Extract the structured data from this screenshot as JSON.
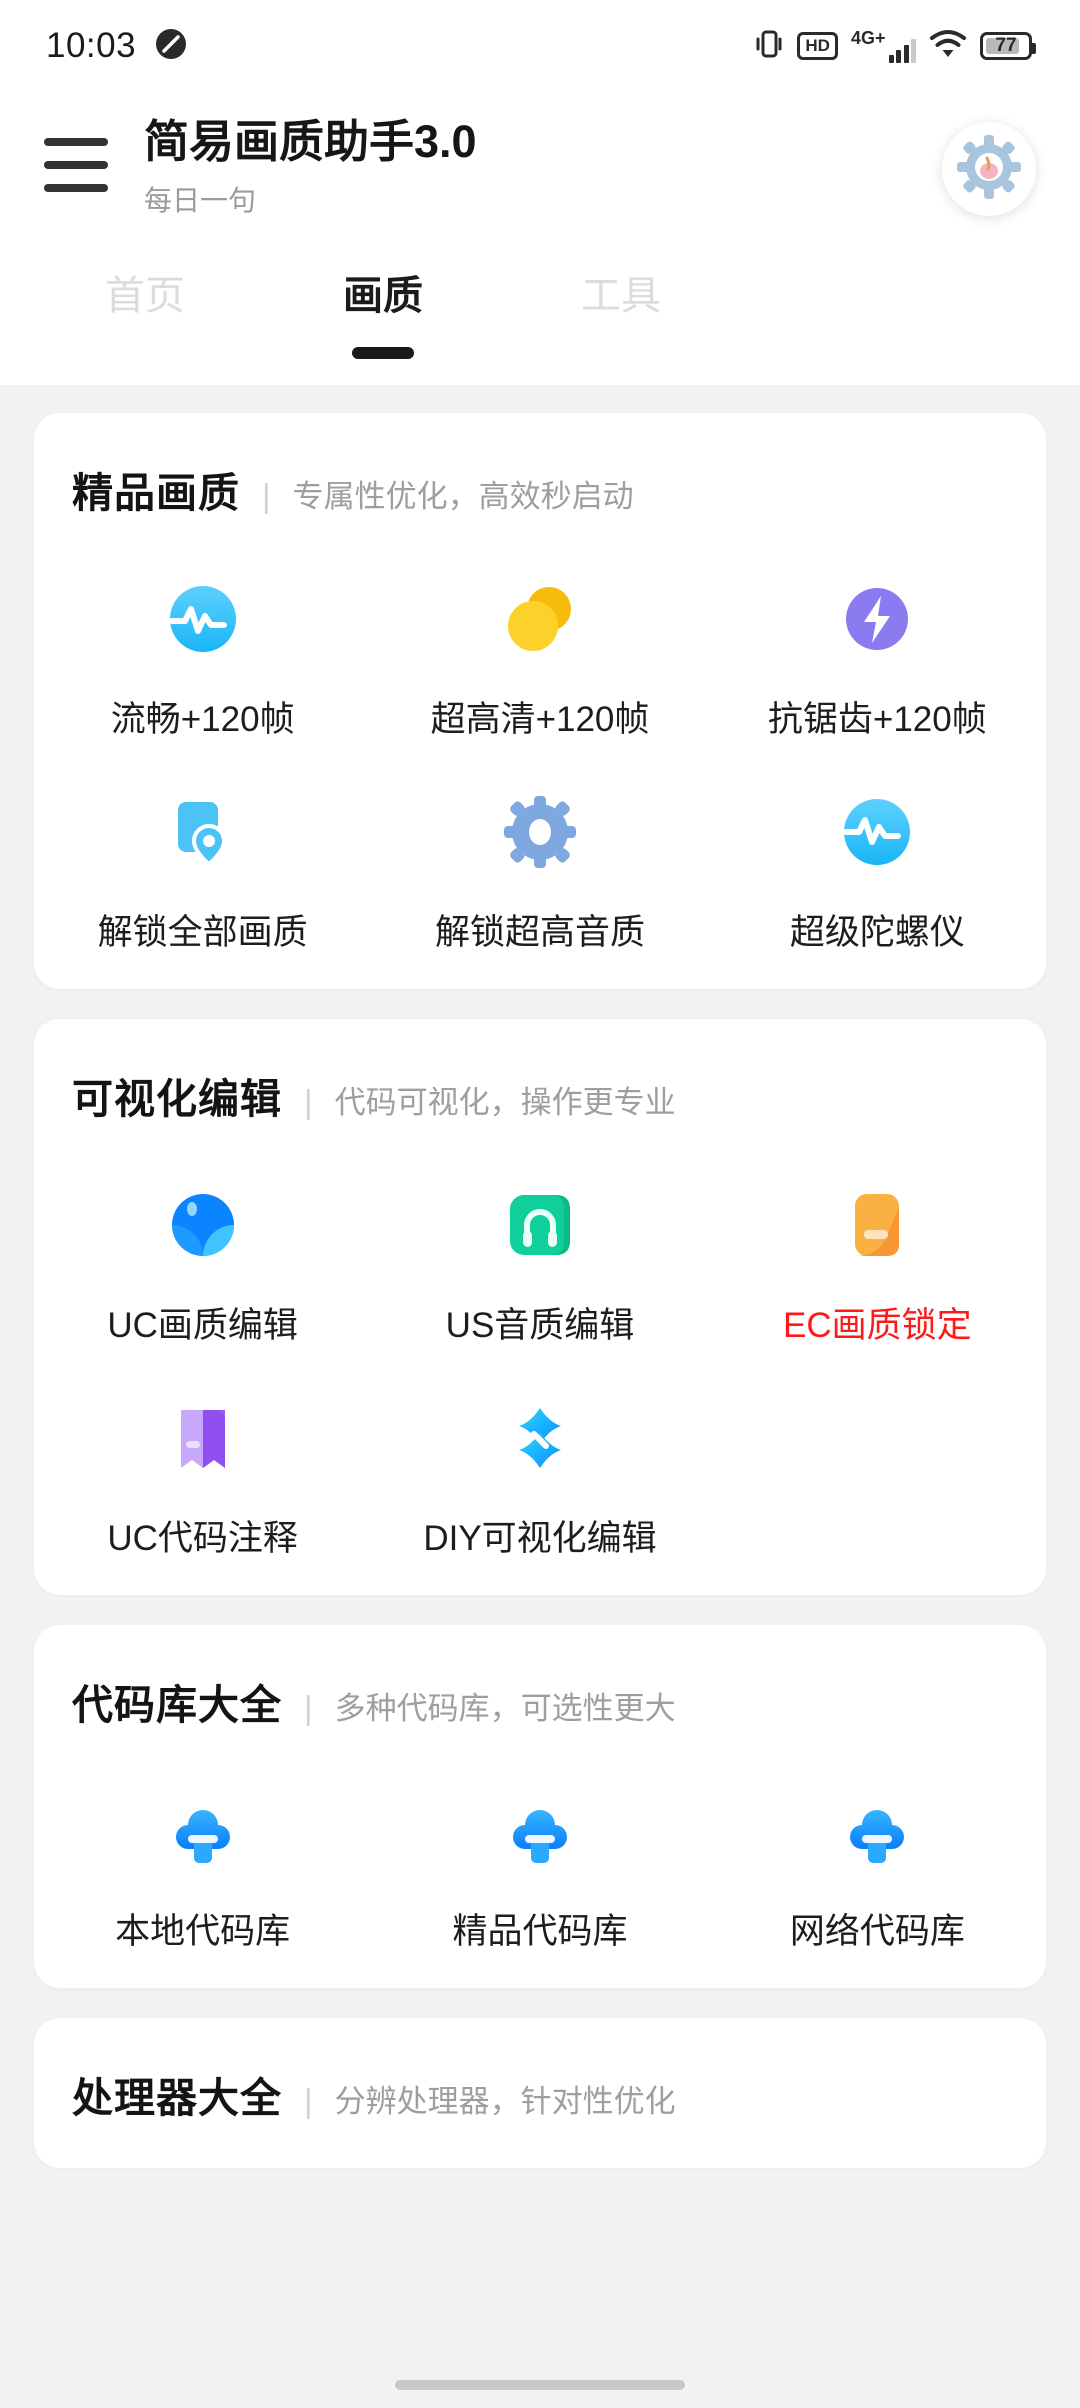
{
  "status_bar": {
    "time": "10:03",
    "icons": [
      "dnd-icon",
      "vibrate-icon",
      "hd-icon",
      "signal-4g-icon",
      "wifi-icon",
      "battery-icon"
    ],
    "hd_label": "HD",
    "network_label": "4G+",
    "battery_level": "77"
  },
  "app_bar": {
    "menu_icon": "hamburger-menu-icon",
    "title": "简易画质助手3.0",
    "subtitle": "每日一句",
    "settings_icon": "gear-icon"
  },
  "tabs": [
    {
      "label": "首页",
      "active": false
    },
    {
      "label": "画质",
      "active": true
    },
    {
      "label": "工具",
      "active": false
    }
  ],
  "cards": [
    {
      "title": "精品画质",
      "divider": "|",
      "subtitle": "专属性优化，高效秒启动",
      "items": [
        {
          "label": "流畅+120帧",
          "icon": "pulse-wave-icon",
          "color": "#3cc0ff",
          "red": false
        },
        {
          "label": "超高清+120帧",
          "icon": "double-circle-icon",
          "color": "#f9c416",
          "red": false
        },
        {
          "label": "抗锯齿+120帧",
          "icon": "lightning-bolt-icon",
          "color": "#8b7bf0",
          "red": false
        },
        {
          "label": "解锁全部画质",
          "icon": "map-pin-card-icon",
          "color": "#4cc3f5",
          "red": false
        },
        {
          "label": "解锁超高音质",
          "icon": "gear-settings-icon",
          "color": "#7fa8e0",
          "red": false
        },
        {
          "label": "超级陀螺仪",
          "icon": "pulse-wave-icon",
          "color": "#3cc0ff",
          "red": false
        }
      ]
    },
    {
      "title": "可视化编辑",
      "divider": "|",
      "subtitle": "代码可视化，操作更专业",
      "items": [
        {
          "label": "UC画质编辑",
          "icon": "blue-sphere-icon",
          "color": "#0a84ff",
          "red": false
        },
        {
          "label": "US音质编辑",
          "icon": "headphone-icon",
          "color": "#0fd09a",
          "red": false
        },
        {
          "label": "EC画质锁定",
          "icon": "orange-lock-icon",
          "color": "#f9a43a",
          "red": true
        },
        {
          "label": "UC代码注释",
          "icon": "purple-book-icon",
          "color": "#a07cf7",
          "red": false
        },
        {
          "label": "DIY可视化编辑",
          "icon": "cyan-cross-icon",
          "color": "#17b7ff",
          "red": false
        }
      ]
    },
    {
      "title": "代码库大全",
      "divider": "|",
      "subtitle": "多种代码库，可选性更大",
      "items": [
        {
          "label": "本地代码库",
          "icon": "cloud-download-icon",
          "color": "#1e9bff",
          "red": false
        },
        {
          "label": "精品代码库",
          "icon": "cloud-download-icon",
          "color": "#1e9bff",
          "red": false
        },
        {
          "label": "网络代码库",
          "icon": "cloud-download-icon",
          "color": "#1e9bff",
          "red": false
        }
      ]
    },
    {
      "title": "处理器大全",
      "divider": "|",
      "subtitle": "分辨处理器，针对性优化",
      "items": []
    }
  ],
  "colors": {
    "page_bg": "#f2f2f4",
    "card_bg": "#ffffff",
    "text_primary": "#1b1b1b",
    "text_muted": "#9e9e9e",
    "accent_red": "#ff1a1a",
    "tab_inactive": "#dcdcdc"
  }
}
